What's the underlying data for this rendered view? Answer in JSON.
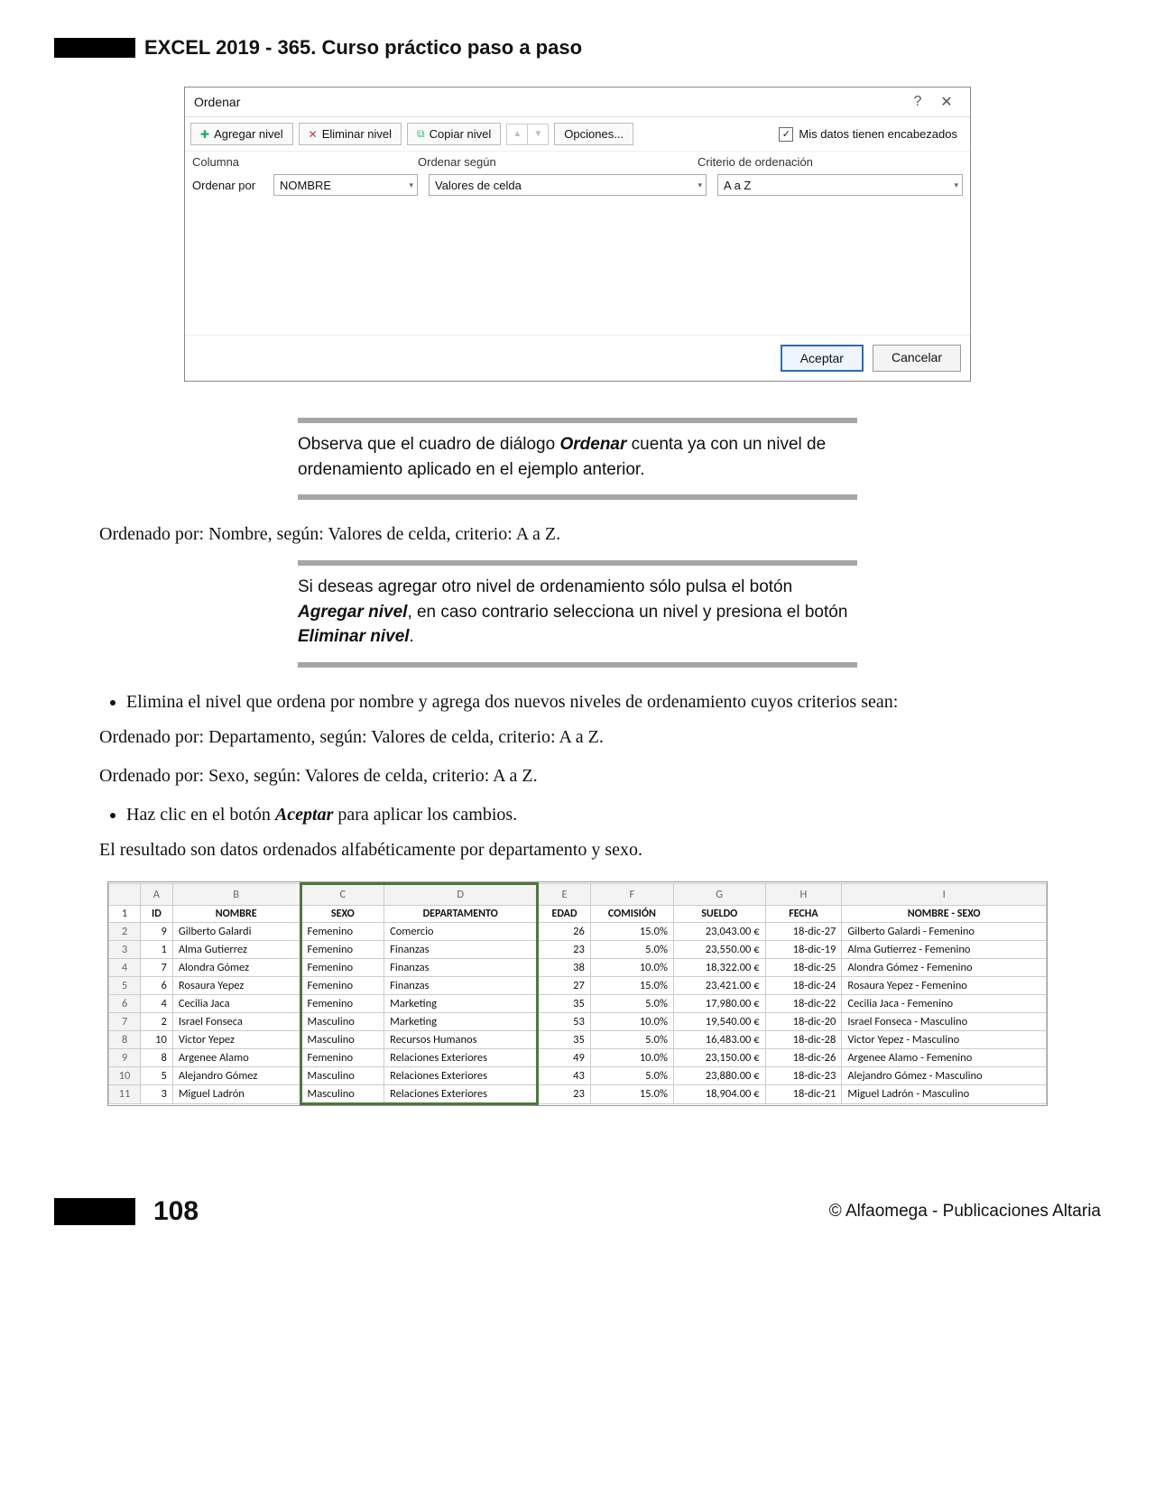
{
  "header": {
    "title": "EXCEL 2019 - 365. Curso práctico paso a paso"
  },
  "dialog": {
    "title": "Ordenar",
    "help": "?",
    "close": "✕",
    "btn_add": "Agregar nivel",
    "btn_del": "Eliminar nivel",
    "btn_copy": "Copiar nivel",
    "btn_options": "Opciones...",
    "chk_label": "Mis datos tienen encabezados",
    "col_h1": "Columna",
    "col_h2": "Ordenar según",
    "col_h3": "Criterio de ordenación",
    "row_label": "Ordenar por",
    "combo1": "NOMBRE",
    "combo2": "Valores de celda",
    "combo3": "A a Z",
    "ok": "Aceptar",
    "cancel": "Cancelar"
  },
  "callout1_a": "Observa que el cuadro de diálogo ",
  "callout1_b": "Ordenar",
  "callout1_c": " cuenta ya con un nivel de ordenamiento aplicado en el ejemplo anterior.",
  "para1": "Ordenado por: Nombre, según: Valores de celda, criterio: A a Z.",
  "callout2_a": "Si deseas agregar otro nivel de ordenamiento sólo pulsa el botón ",
  "callout2_b": "Agregar nivel",
  "callout2_c": ", en caso contrario selecciona un nivel y presiona el botón ",
  "callout2_d": "Eliminar nivel",
  "callout2_e": ".",
  "bullet1": "Elimina el nivel que ordena por nombre y agrega dos nuevos niveles de ordenamiento cuyos criterios sean:",
  "para2": "Ordenado por: Departamento, según: Valores de celda, criterio: A a Z.",
  "para3": "Ordenado por: Sexo, según: Valores de celda, criterio: A a Z.",
  "bullet2_a": "Haz clic en el botón ",
  "bullet2_b": "Aceptar",
  "bullet2_c": " para aplicar los cambios.",
  "para4": "El resultado son datos ordenados alfabéticamente por departamento y sexo.",
  "sheet": {
    "cols": [
      "",
      "A",
      "B",
      "C",
      "D",
      "E",
      "F",
      "G",
      "H",
      "I"
    ],
    "head": [
      "ID",
      "NOMBRE",
      "SEXO",
      "DEPARTAMENTO",
      "EDAD",
      "COMISIÓN",
      "SUELDO",
      "FECHA",
      "NOMBRE - SEXO"
    ],
    "rows": [
      {
        "n": "2",
        "id": "9",
        "nombre": "Gilberto Galardi",
        "sexo": "Femenino",
        "dep": "Comercio",
        "edad": "26",
        "com": "15.0%",
        "sueldo": "23,043.00 €",
        "fecha": "18-dic-27",
        "ns": "Gilberto Galardi - Femenino"
      },
      {
        "n": "3",
        "id": "1",
        "nombre": "Alma Gutierrez",
        "sexo": "Femenino",
        "dep": "Finanzas",
        "edad": "23",
        "com": "5.0%",
        "sueldo": "23,550.00 €",
        "fecha": "18-dic-19",
        "ns": "Alma Gutierrez - Femenino"
      },
      {
        "n": "4",
        "id": "7",
        "nombre": "Alondra Gómez",
        "sexo": "Femenino",
        "dep": "Finanzas",
        "edad": "38",
        "com": "10.0%",
        "sueldo": "18,322.00 €",
        "fecha": "18-dic-25",
        "ns": "Alondra Gómez - Femenino"
      },
      {
        "n": "5",
        "id": "6",
        "nombre": "Rosaura Yepez",
        "sexo": "Femenino",
        "dep": "Finanzas",
        "edad": "27",
        "com": "15.0%",
        "sueldo": "23,421.00 €",
        "fecha": "18-dic-24",
        "ns": "Rosaura Yepez - Femenino"
      },
      {
        "n": "6",
        "id": "4",
        "nombre": "Cecilia Jaca",
        "sexo": "Femenino",
        "dep": "Marketing",
        "edad": "35",
        "com": "5.0%",
        "sueldo": "17,980.00 €",
        "fecha": "18-dic-22",
        "ns": "Cecilia Jaca - Femenino"
      },
      {
        "n": "7",
        "id": "2",
        "nombre": "Israel Fonseca",
        "sexo": "Masculino",
        "dep": "Marketing",
        "edad": "53",
        "com": "10.0%",
        "sueldo": "19,540.00 €",
        "fecha": "18-dic-20",
        "ns": "Israel Fonseca - Masculino"
      },
      {
        "n": "8",
        "id": "10",
        "nombre": "Victor Yepez",
        "sexo": "Masculino",
        "dep": "Recursos Humanos",
        "edad": "35",
        "com": "5.0%",
        "sueldo": "16,483.00 €",
        "fecha": "18-dic-28",
        "ns": "Victor Yepez - Masculino"
      },
      {
        "n": "9",
        "id": "8",
        "nombre": "Argenee Alamo",
        "sexo": "Femenino",
        "dep": "Relaciones Exteriores",
        "edad": "49",
        "com": "10.0%",
        "sueldo": "23,150.00 €",
        "fecha": "18-dic-26",
        "ns": "Argenee Alamo - Femenino"
      },
      {
        "n": "10",
        "id": "5",
        "nombre": "Alejandro Gómez",
        "sexo": "Masculino",
        "dep": "Relaciones Exteriores",
        "edad": "43",
        "com": "5.0%",
        "sueldo": "23,880.00 €",
        "fecha": "18-dic-23",
        "ns": "Alejandro Gómez - Masculino"
      },
      {
        "n": "11",
        "id": "3",
        "nombre": "Miguel Ladrón",
        "sexo": "Masculino",
        "dep": "Relaciones Exteriores",
        "edad": "23",
        "com": "15.0%",
        "sueldo": "18,904.00 €",
        "fecha": "18-dic-21",
        "ns": "Miguel Ladrón - Masculino"
      }
    ]
  },
  "footer": {
    "page": "108",
    "copyright": "© Alfaomega - Publicaciones Altaria"
  }
}
